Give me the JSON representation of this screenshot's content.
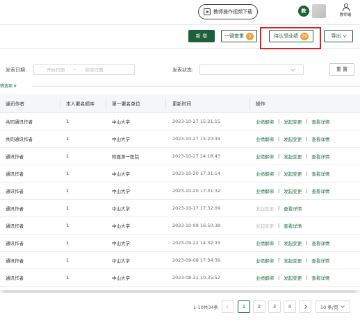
{
  "header": {
    "video_button_label": "教师操作视频下载",
    "avatar_badge_text": "教",
    "user_menu_label": "教师端"
  },
  "toolbar": {
    "new_label": "新 增",
    "check_duplicates_label": "一键查重",
    "check_duplicates_count": "0",
    "pending_confirm_label": "待认领业绩",
    "pending_confirm_count": "29",
    "export_label": "导出"
  },
  "filters": {
    "publish_date_label": "发表日期:",
    "start_date_placeholder": "开始日期",
    "date_separator": "~",
    "end_date_placeholder": "结束日期",
    "publish_status_label": "发表状态:",
    "reset_label": "重 置",
    "filter_tag_label": "筛选项 ¥"
  },
  "table": {
    "columns": [
      "通讯作者",
      "本人署名顺序",
      "第一署名单位",
      "更新时间",
      "操作"
    ],
    "rows": [
      {
        "author": "共同通讯作者",
        "order": "1",
        "unit": "中山大学",
        "updated": "2023-10-27 15:21:15",
        "ops": [
          "业绩解绑",
          "发起变更",
          "查看详情"
        ],
        "disabled_first": false
      },
      {
        "author": "共同通讯作者",
        "order": "1",
        "unit": "中山大学",
        "updated": "2023-10-27 15:20:34",
        "ops": [
          "业绩解绑",
          "发起变更",
          "查看详情"
        ],
        "disabled_first": false
      },
      {
        "author": "通讯作者",
        "order": "1",
        "unit": "附属第一医院",
        "updated": "2023-10-27 14:18:43",
        "ops": [
          "业绩解绑",
          "发起变更",
          "查看详情"
        ],
        "disabled_first": false
      },
      {
        "author": "通讯作者",
        "order": "1",
        "unit": "中山大学",
        "updated": "2023-10-20 17:31:14",
        "ops": [
          "业绩解绑",
          "发起变更",
          "查看详情"
        ],
        "disabled_first": false
      },
      {
        "author": "通讯作者",
        "order": "1",
        "unit": "中山大学",
        "updated": "2023-10-20 17:31:32",
        "ops": [
          "业绩解绑",
          "发起变更",
          "查看详情"
        ],
        "disabled_first": false
      },
      {
        "author": "通讯作者",
        "order": "1",
        "unit": "中山大学",
        "updated": "2023-10-17 17:32:09",
        "ops": [
          "发起变更",
          "查看详情"
        ],
        "disabled_first": true
      },
      {
        "author": "通讯作者",
        "order": "1",
        "unit": "中山大学",
        "updated": "2023-10-09 16:50:38",
        "ops": [
          "发起变更",
          "查看详情"
        ],
        "disabled_first": true
      },
      {
        "author": "通讯作者",
        "order": "1",
        "unit": "中山大学",
        "updated": "2023-09-22 14:32:33",
        "ops": [
          "业绩解绑",
          "发起变更",
          "查看详情"
        ],
        "disabled_first": false
      },
      {
        "author": "通讯作者",
        "order": "1",
        "unit": "中山大学",
        "updated": "2023-09-08 17:34:39",
        "ops": [
          "业绩解绑",
          "发起变更",
          "查看详情"
        ],
        "disabled_first": false
      },
      {
        "author": "通讯作者",
        "order": "1",
        "unit": "中山大学",
        "updated": "2023-08-31 10:35:52",
        "ops": [
          "业绩解绑",
          "发起变更",
          "查看详情"
        ],
        "disabled_first": false
      }
    ]
  },
  "pagination": {
    "total_text": "1-10共34条",
    "pages": [
      "1",
      "2",
      "3",
      "4"
    ],
    "current_page": "1",
    "page_size": "10 条/页"
  },
  "colors": {
    "primary": "#1f5f3a",
    "badge_orange": "#e9a33a",
    "highlight_red": "#e02020"
  }
}
